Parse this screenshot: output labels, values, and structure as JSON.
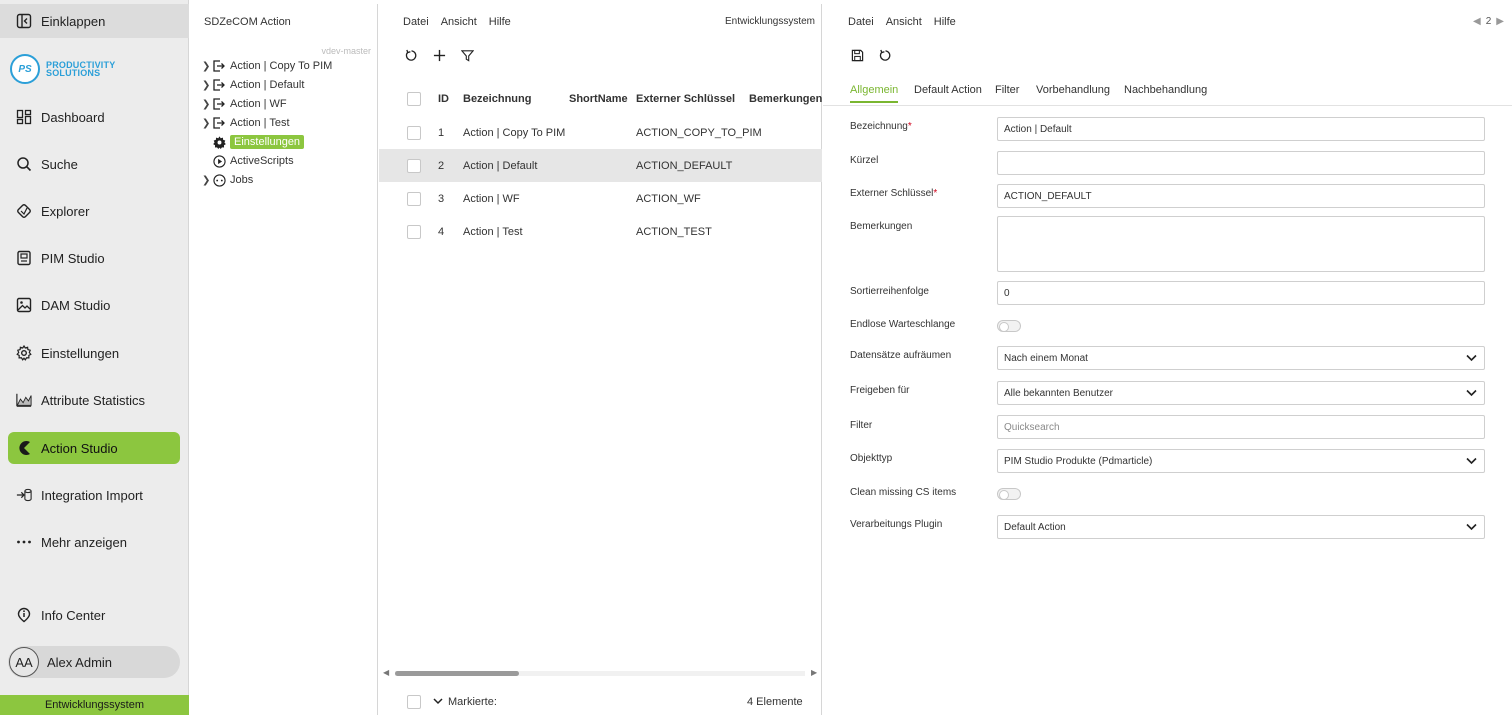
{
  "sidebar": {
    "collapse_label": "Einklappen",
    "logo_mark": "PS",
    "logo_line1": "PRODUCTIVITY",
    "logo_line2": "SOLUTIONS",
    "items": [
      {
        "label": "Dashboard",
        "icon": "dashboard-icon"
      },
      {
        "label": "Suche",
        "icon": "search-icon"
      },
      {
        "label": "Explorer",
        "icon": "explorer-icon"
      },
      {
        "label": "PIM Studio",
        "icon": "pim-icon"
      },
      {
        "label": "DAM Studio",
        "icon": "image-icon"
      },
      {
        "label": "Einstellungen",
        "icon": "gear-icon"
      },
      {
        "label": "Attribute Statistics",
        "icon": "statistics-icon"
      },
      {
        "label": "Action Studio",
        "icon": "action-icon"
      },
      {
        "label": "Integration Import",
        "icon": "import-icon"
      },
      {
        "label": "Mehr anzeigen",
        "icon": "more-icon"
      }
    ],
    "info_center": "Info Center",
    "user_initials": "AA",
    "user_name": "Alex Admin",
    "environment": "Entwicklungssystem",
    "accent_color": "#8cc63f"
  },
  "tree": {
    "title": "SDZeCOM Action",
    "branch": "vdev-master",
    "nodes": [
      {
        "label": "Action | Copy To PIM"
      },
      {
        "label": "Action | Default"
      },
      {
        "label": "Action | WF"
      },
      {
        "label": "Action | Test"
      },
      {
        "label": "Einstellungen"
      },
      {
        "label": "ActiveScripts"
      },
      {
        "label": "Jobs"
      }
    ]
  },
  "list": {
    "menu": [
      "Datei",
      "Ansicht",
      "Hilfe"
    ],
    "environment": "Entwicklungssystem",
    "columns": {
      "id": "ID",
      "bezeichnung": "Bezeichnung",
      "shortname": "ShortName",
      "extern": "Externer Schlüssel",
      "bemerkungen": "Bemerkungen"
    },
    "rows": [
      {
        "id": "1",
        "bezeichnung": "Action | Copy To PIM",
        "extern": "ACTION_COPY_TO_PIM"
      },
      {
        "id": "2",
        "bezeichnung": "Action | Default",
        "extern": "ACTION_DEFAULT"
      },
      {
        "id": "3",
        "bezeichnung": "Action | WF",
        "extern": "ACTION_WF"
      },
      {
        "id": "4",
        "bezeichnung": "Action | Test",
        "extern": "ACTION_TEST"
      }
    ],
    "footer_marked": "Markierte:",
    "footer_count": "4 Elemente"
  },
  "detail": {
    "menu": [
      "Datei",
      "Ansicht",
      "Hilfe"
    ],
    "pager": "2",
    "tabs": [
      "Allgemein",
      "Default Action",
      "Filter",
      "Vorbehandlung",
      "Nachbehandlung"
    ],
    "fields": {
      "bezeichnung_label": "Bezeichnung",
      "bezeichnung_value": "Action | Default",
      "kuerzel_label": "Kürzel",
      "kuerzel_value": "",
      "extern_label": "Externer Schlüssel",
      "extern_value": "ACTION_DEFAULT",
      "bemerkungen_label": "Bemerkungen",
      "bemerkungen_value": "",
      "sortierung_label": "Sortierreihenfolge",
      "sortierung_value": "0",
      "endlos_label": "Endlose Warteschlange",
      "datensaetze_label": "Datensätze aufräumen",
      "datensaetze_value": "Nach einem Monat",
      "freigeben_label": "Freigeben für",
      "freigeben_value": "Alle bekannten Benutzer",
      "filter_label": "Filter",
      "filter_placeholder": "Quicksearch",
      "objekttyp_label": "Objekttyp",
      "objekttyp_value": "PIM Studio Produkte (Pdmarticle)",
      "clean_label": "Clean missing CS items",
      "plugin_label": "Verarbeitungs Plugin",
      "plugin_value": "Default Action"
    }
  }
}
